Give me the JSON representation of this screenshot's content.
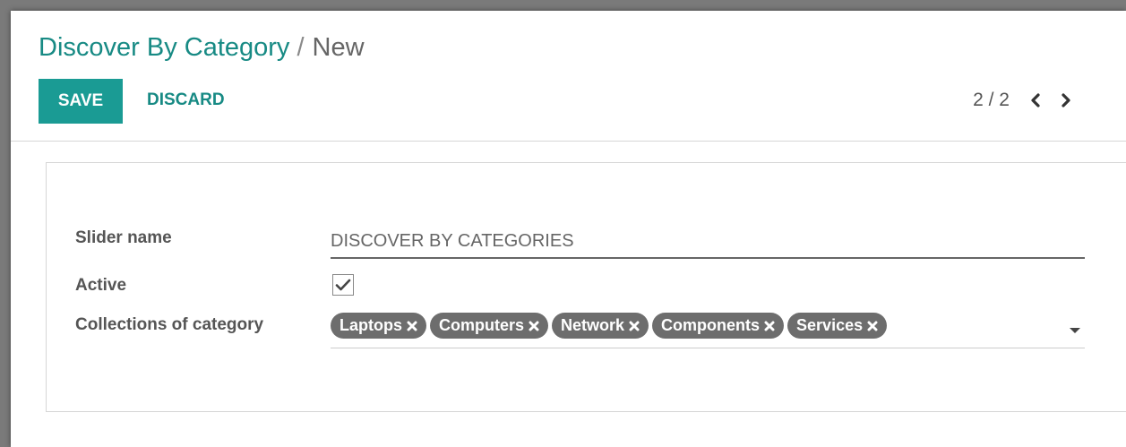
{
  "breadcrumb": {
    "parent": "Discover By Category",
    "separator": "/",
    "current": "New"
  },
  "toolbar": {
    "save_label": "SAVE",
    "discard_label": "DISCARD"
  },
  "pager": {
    "value": "2 / 2"
  },
  "form": {
    "slider_name": {
      "label": "Slider name",
      "value": "DISCOVER BY CATEGORIES"
    },
    "active": {
      "label": "Active",
      "checked": true
    },
    "collections": {
      "label": "Collections of category",
      "tags": [
        "Laptops",
        "Computers",
        "Network",
        "Components",
        "Services"
      ]
    }
  },
  "colors": {
    "brand": "#1a9b94",
    "link": "#178a84",
    "tag_bg": "#6d6d6d"
  },
  "icons": {
    "pager_prev": "chevron-left-icon",
    "pager_next": "chevron-right-icon",
    "checkbox": "checkmark-icon",
    "tag_remove": "close-x-icon",
    "dropdown": "caret-down-icon"
  }
}
